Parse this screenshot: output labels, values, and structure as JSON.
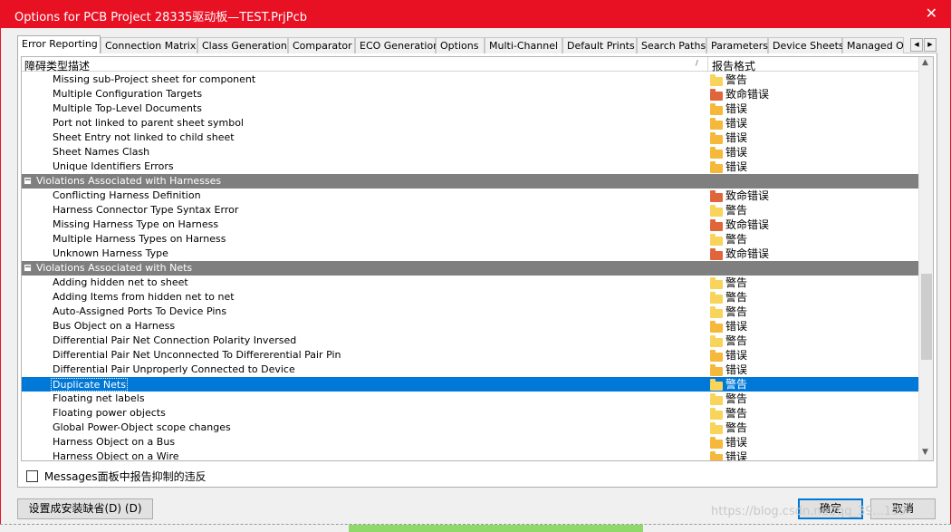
{
  "window": {
    "title": "Options for PCB Project 28335驱动板—TEST.PrjPcb",
    "close_glyph": "✕"
  },
  "tabs": [
    {
      "label": "Error Reporting",
      "active": true
    },
    {
      "label": "Connection Matrix"
    },
    {
      "label": "Class Generation"
    },
    {
      "label": "Comparator"
    },
    {
      "label": "ECO Generation"
    },
    {
      "label": "Options"
    },
    {
      "label": "Multi-Channel"
    },
    {
      "label": "Default Prints"
    },
    {
      "label": "Search Paths"
    },
    {
      "label": "Parameters"
    },
    {
      "label": "Device Sheets"
    },
    {
      "label": "Managed O"
    }
  ],
  "tab_scroll": {
    "left": "◀",
    "right": "▶"
  },
  "grid": {
    "col1": "障碍类型描述",
    "sort_glyph": "/",
    "col2": "报告格式",
    "scroll_up": "▲",
    "scroll_down": "▼",
    "levels": {
      "warn": {
        "label": "警告",
        "color": "#f8d45a"
      },
      "error": {
        "label": "错误",
        "color": "#f5b83a"
      },
      "fatal": {
        "label": "致命错误",
        "color": "#e0653a"
      }
    },
    "rows": [
      {
        "type": "item",
        "name": "Missing sub-Project sheet for component",
        "level": "warn"
      },
      {
        "type": "item",
        "name": "Multiple Configuration Targets",
        "level": "fatal"
      },
      {
        "type": "item",
        "name": "Multiple Top-Level Documents",
        "level": "error"
      },
      {
        "type": "item",
        "name": "Port not linked to parent sheet symbol",
        "level": "error"
      },
      {
        "type": "item",
        "name": "Sheet Entry not linked to child sheet",
        "level": "error"
      },
      {
        "type": "item",
        "name": "Sheet Names Clash",
        "level": "error"
      },
      {
        "type": "item",
        "name": "Unique Identifiers Errors",
        "level": "error"
      },
      {
        "type": "group",
        "name": "Violations Associated with Harnesses",
        "toggle": "−"
      },
      {
        "type": "item",
        "name": "Conflicting Harness Definition",
        "level": "fatal"
      },
      {
        "type": "item",
        "name": "Harness Connector Type Syntax Error",
        "level": "warn"
      },
      {
        "type": "item",
        "name": "Missing Harness Type on Harness",
        "level": "fatal"
      },
      {
        "type": "item",
        "name": "Multiple Harness Types on Harness",
        "level": "warn"
      },
      {
        "type": "item",
        "name": "Unknown Harness Type",
        "level": "fatal"
      },
      {
        "type": "group",
        "name": "Violations Associated with Nets",
        "toggle": "−"
      },
      {
        "type": "item",
        "name": "Adding hidden net to sheet",
        "level": "warn"
      },
      {
        "type": "item",
        "name": "Adding Items from hidden net to net",
        "level": "warn"
      },
      {
        "type": "item",
        "name": "Auto-Assigned Ports To Device Pins",
        "level": "warn"
      },
      {
        "type": "item",
        "name": "Bus Object on a Harness",
        "level": "error"
      },
      {
        "type": "item",
        "name": "Differential Pair Net Connection Polarity Inversed",
        "level": "warn"
      },
      {
        "type": "item",
        "name": "Differential Pair Net Unconnected To Differerential Pair Pin",
        "level": "error"
      },
      {
        "type": "item",
        "name": "Differential Pair Unproperly Connected to Device",
        "level": "error"
      },
      {
        "type": "item",
        "name": "Duplicate Nets",
        "level": "warn",
        "selected": true
      },
      {
        "type": "item",
        "name": "Floating net labels",
        "level": "warn"
      },
      {
        "type": "item",
        "name": "Floating power objects",
        "level": "warn"
      },
      {
        "type": "item",
        "name": "Global Power-Object scope changes",
        "level": "warn"
      },
      {
        "type": "item",
        "name": "Harness Object on a Bus",
        "level": "error"
      },
      {
        "type": "item",
        "name": "Harness Object on a Wire",
        "level": "error"
      }
    ]
  },
  "checkbox": {
    "label": "Messages面板中报告抑制的违反",
    "checked": false
  },
  "buttons": {
    "defaults": "设置成安装缺省(D) (D)",
    "ok": "确定",
    "cancel": "取消"
  },
  "watermark": "https://blog.csdn.net/qq_39...159"
}
